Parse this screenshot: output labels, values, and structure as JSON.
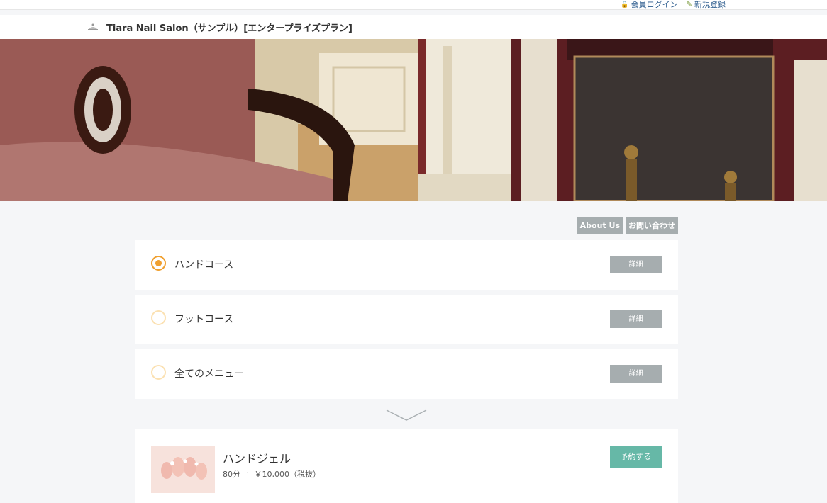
{
  "topbar": {
    "login_label": "会員ログイン",
    "register_label": "新規登録"
  },
  "header": {
    "title": "Tiara Nail Salon（サンプル）[エンタープライズプラン]"
  },
  "nav": {
    "about_label": "About Us",
    "contact_label": "お問い合わせ"
  },
  "courses": [
    {
      "label": "ハンドコース",
      "selected": true,
      "detail_label": "詳細"
    },
    {
      "label": "フットコース",
      "selected": false,
      "detail_label": "詳細"
    },
    {
      "label": "全てのメニュー",
      "selected": false,
      "detail_label": "詳細"
    }
  ],
  "menu_item": {
    "name": "ハンドジェル",
    "duration": "80分",
    "price": "￥10,000（税抜）",
    "reserve_label": "予約する"
  },
  "colors": {
    "accent": "#f0a030",
    "detail_button": "#a6adaf",
    "reserve_button": "#66b8a7",
    "background": "#f5f6f8"
  }
}
